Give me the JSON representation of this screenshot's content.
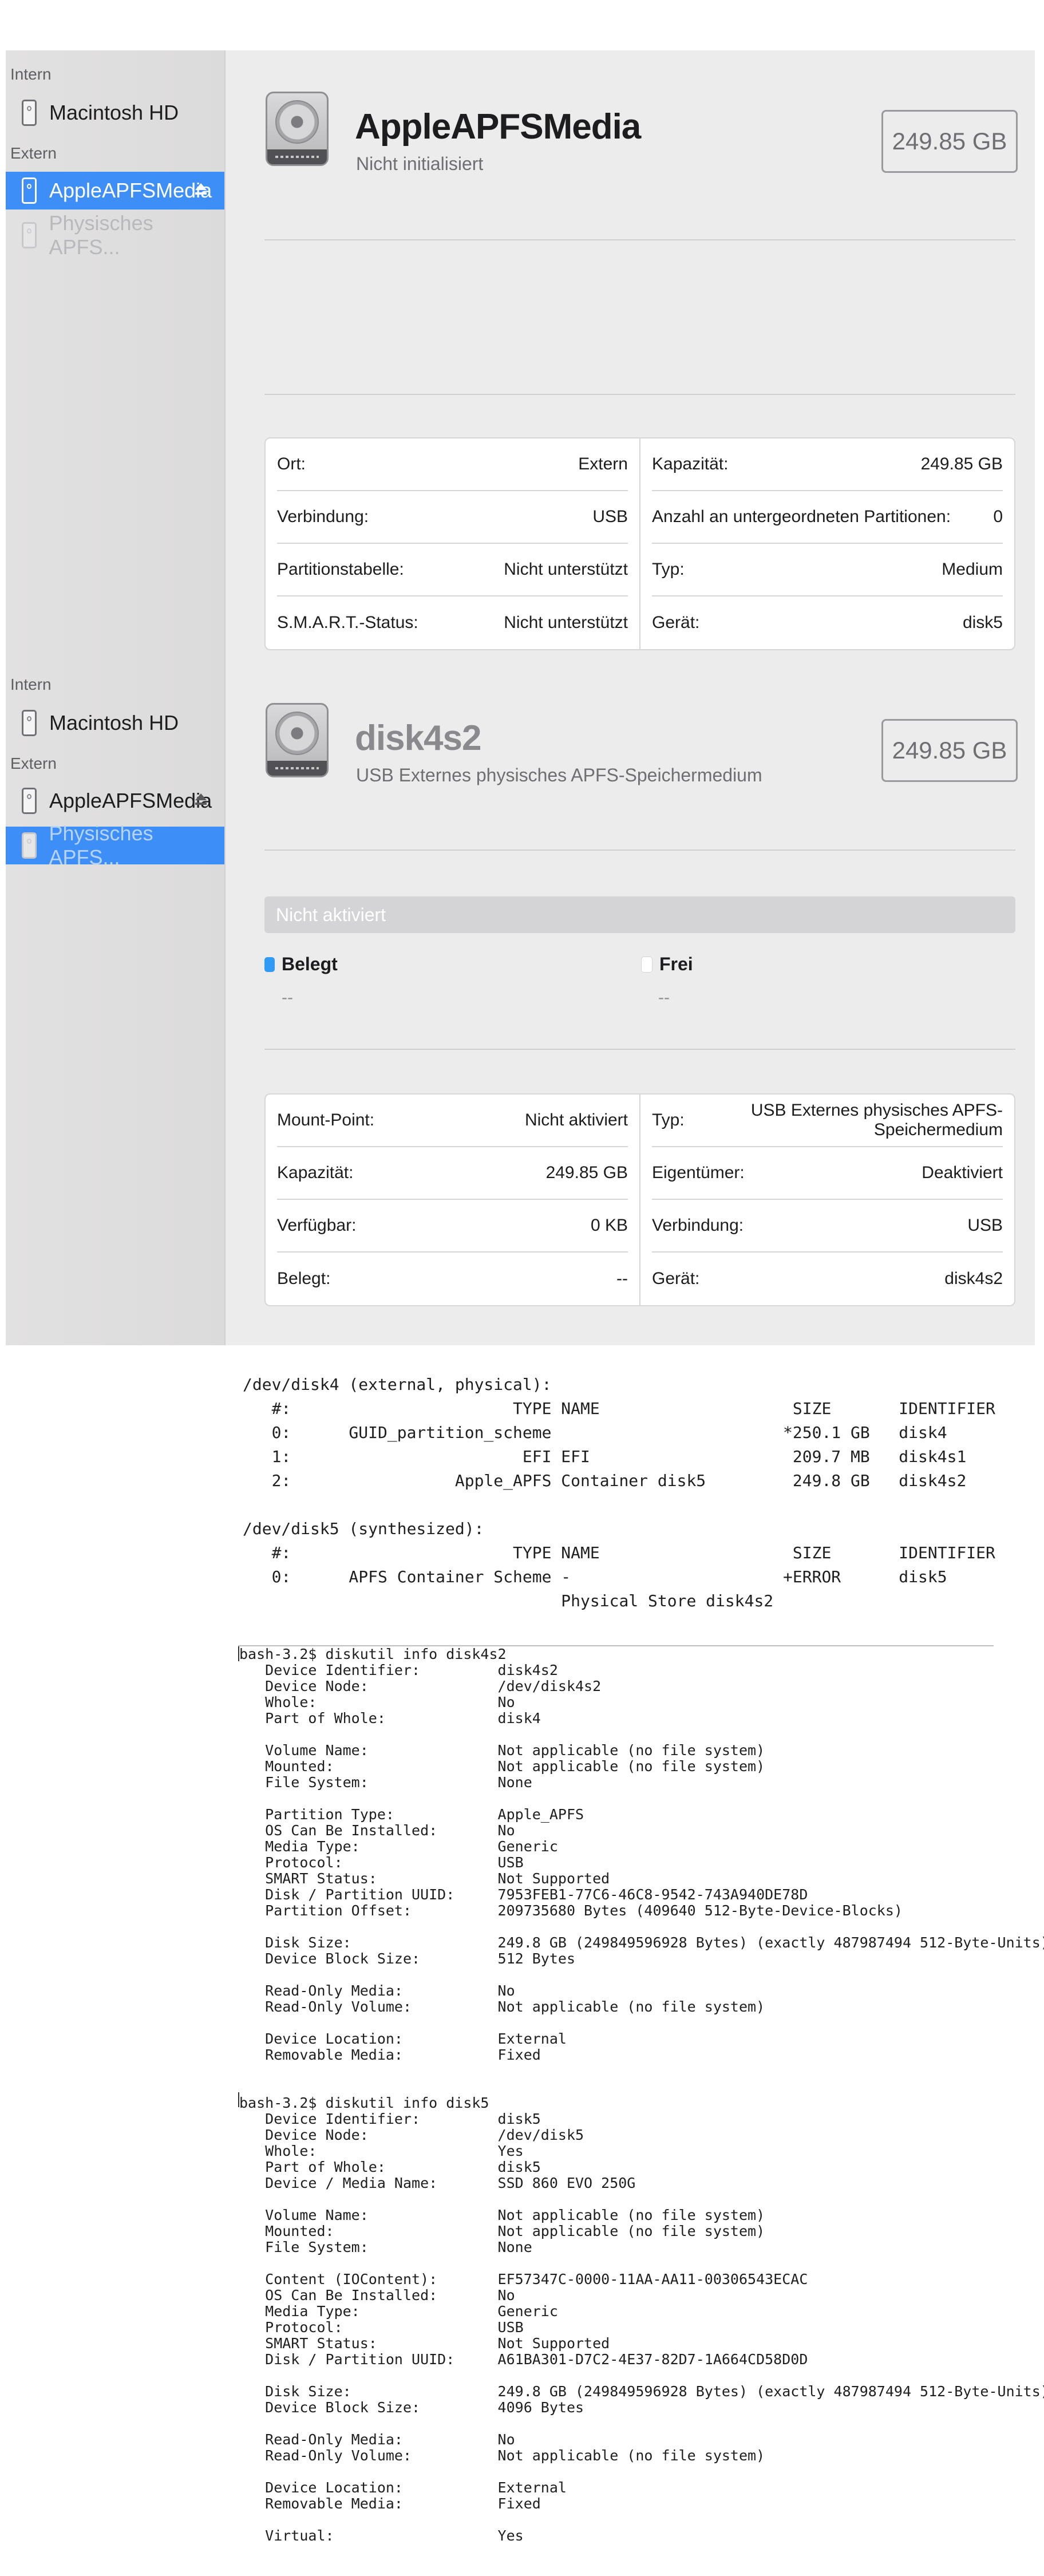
{
  "panel1": {
    "sidebar": {
      "section_internal": "Intern",
      "section_external": "Extern",
      "item_internal": "Macintosh HD",
      "item_media": "AppleAPFSMedia",
      "item_store": "Physisches APFS..."
    },
    "header": {
      "title": "AppleAPFSMedia",
      "subtitle": "Nicht initialisiert",
      "size": "249.85 GB"
    },
    "info": {
      "left": [
        {
          "label": "Ort:",
          "value": "Extern"
        },
        {
          "label": "Verbindung:",
          "value": "USB"
        },
        {
          "label": "Partitionstabelle:",
          "value": "Nicht unterstützt"
        },
        {
          "label": "S.M.A.R.T.-Status:",
          "value": "Nicht unterstützt"
        }
      ],
      "right": [
        {
          "label": "Kapazität:",
          "value": "249.85 GB"
        },
        {
          "label": "Anzahl an untergeordneten Partitionen:",
          "value": "0"
        },
        {
          "label": "Typ:",
          "value": "Medium"
        },
        {
          "label": "Gerät:",
          "value": "disk5"
        }
      ]
    }
  },
  "panel2": {
    "sidebar": {
      "section_internal": "Intern",
      "section_external": "Extern",
      "item_internal": "Macintosh HD",
      "item_media": "AppleAPFSMedia",
      "item_store": "Physisches APFS..."
    },
    "header": {
      "title": "disk4s2",
      "subtitle": "USB Externes physisches APFS-Speichermedium",
      "size": "249.85 GB"
    },
    "usage": {
      "bar_label": "Nicht aktiviert",
      "used_label": "Belegt",
      "used_value": "--",
      "free_label": "Frei",
      "free_value": "--",
      "used_color": "#2f9bf5",
      "free_color": "#ffffff"
    },
    "info": {
      "left": [
        {
          "label": "Mount-Point:",
          "value": "Nicht aktiviert"
        },
        {
          "label": "Kapazität:",
          "value": "249.85 GB"
        },
        {
          "label": "Verfügbar:",
          "value": "0 KB"
        },
        {
          "label": "Belegt:",
          "value": "--"
        }
      ],
      "right": [
        {
          "label": "Typ:",
          "value": "USB Externes physisches APFS-Speichermedium"
        },
        {
          "label": "Eigentümer:",
          "value": "Deaktiviert"
        },
        {
          "label": "Verbindung:",
          "value": "USB"
        },
        {
          "label": "Gerät:",
          "value": "disk4s2"
        }
      ]
    }
  },
  "terminal": {
    "list_output": "/dev/disk4 (external, physical):\n   #:                       TYPE NAME                    SIZE       IDENTIFIER\n   0:      GUID_partition_scheme                        *250.1 GB   disk4\n   1:                        EFI EFI                     209.7 MB   disk4s1\n   2:                 Apple_APFS Container disk5         249.8 GB   disk4s2\n\n/dev/disk5 (synthesized):\n   #:                       TYPE NAME                    SIZE       IDENTIFIER\n   0:      APFS Container Scheme -                      +ERROR      disk5\n                                 Physical Store disk4s2",
    "info_output": "bash-3.2$ diskutil info disk4s2\n   Device Identifier:         disk4s2\n   Device Node:               /dev/disk4s2\n   Whole:                     No\n   Part of Whole:             disk4\n\n   Volume Name:               Not applicable (no file system)\n   Mounted:                   Not applicable (no file system)\n   File System:               None\n\n   Partition Type:            Apple_APFS\n   OS Can Be Installed:       No\n   Media Type:                Generic\n   Protocol:                  USB\n   SMART Status:              Not Supported\n   Disk / Partition UUID:     7953FEB1-77C6-46C8-9542-743A940DE78D\n   Partition Offset:          209735680 Bytes (409640 512-Byte-Device-Blocks)\n\n   Disk Size:                 249.8 GB (249849596928 Bytes) (exactly 487987494 512-Byte-Units)\n   Device Block Size:         512 Bytes\n\n   Read-Only Media:           No\n   Read-Only Volume:          Not applicable (no file system)\n\n   Device Location:           External\n   Removable Media:           Fixed\n\n\nbash-3.2$ diskutil info disk5\n   Device Identifier:         disk5\n   Device Node:               /dev/disk5\n   Whole:                     Yes\n   Part of Whole:             disk5\n   Device / Media Name:       SSD 860 EVO 250G\n\n   Volume Name:               Not applicable (no file system)\n   Mounted:                   Not applicable (no file system)\n   File System:               None\n\n   Content (IOContent):       EF57347C-0000-11AA-AA11-00306543ECAC\n   OS Can Be Installed:       No\n   Media Type:                Generic\n   Protocol:                  USB\n   SMART Status:              Not Supported\n   Disk / Partition UUID:     A61BA301-D7C2-4E37-82D7-1A664CD58D0D\n\n   Disk Size:                 249.8 GB (249849596928 Bytes) (exactly 487987494 512-Byte-Units)\n   Device Block Size:         4096 Bytes\n\n   Read-Only Media:           No\n   Read-Only Volume:          Not applicable (no file system)\n\n   Device Location:           External\n   Removable Media:           Fixed\n\n   Virtual:                   Yes"
  }
}
